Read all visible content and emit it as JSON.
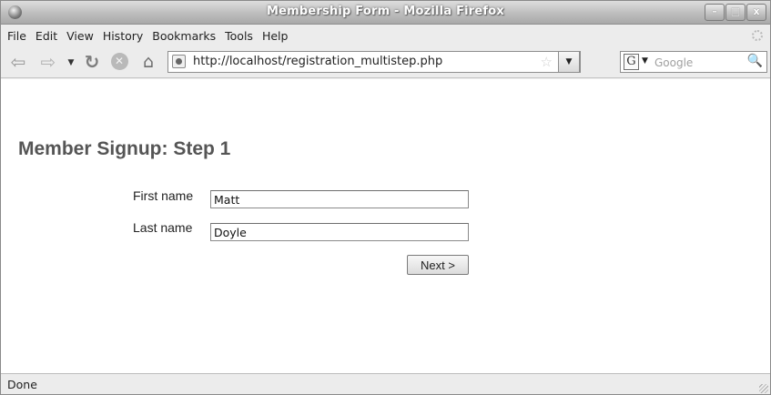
{
  "window": {
    "title": "Membership Form - Mozilla Firefox",
    "buttons": {
      "minimize_glyph": "–",
      "maximize_glyph": "□",
      "close_glyph": "x"
    }
  },
  "menu": {
    "items": [
      "File",
      "Edit",
      "View",
      "History",
      "Bookmarks",
      "Tools",
      "Help"
    ]
  },
  "toolbar": {
    "back_glyph": "⇦",
    "forward_glyph": "⇨",
    "history_dropdown_glyph": "▼",
    "reload_glyph": "↻",
    "stop_glyph": "✕",
    "home_glyph": "⌂",
    "url": "http://localhost/registration_multistep.php",
    "star_glyph": "☆",
    "url_dropdown_glyph": "▼",
    "search_engine_glyph": "G",
    "search_engine_arrow": "▼",
    "search_placeholder": "Google",
    "magnifier_glyph": "🔍"
  },
  "page": {
    "title": "Member Signup: Step 1",
    "first_name_label": "First name",
    "first_name_value": "Matt",
    "last_name_label": "Last name",
    "last_name_value": "Doyle",
    "next_button": "Next >"
  },
  "status": {
    "text": "Done"
  },
  "icons": [
    "firefox-app-icon",
    "back-icon",
    "forward-icon",
    "reload-icon",
    "stop-icon",
    "home-icon",
    "site-identity-icon",
    "star-icon",
    "magnifier-icon",
    "throbber-icon"
  ]
}
